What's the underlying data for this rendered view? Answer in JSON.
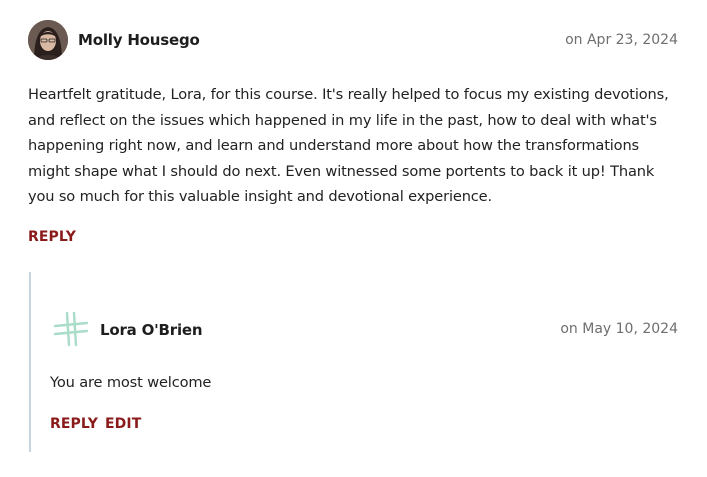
{
  "comment": {
    "author": "Molly Housego",
    "date": "on Apr 23, 2024",
    "lines": [
      "Heartfelt gratitude, Lora, for this course. It's really helped to focus my existing devotions,",
      "and reflect on the issues which happened in my life in the past, how to deal with what's",
      "happening right now, and learn and understand more about how the transformations",
      "might shape what I should do next. Even witnessed some portents to back it up! Thank",
      "you so much for this valuable insight and devotional experience."
    ],
    "reply_label": "REPLY"
  },
  "reply": {
    "author": "Lora O'Brien",
    "date": "on May 10, 2024",
    "text": "You are most welcome",
    "reply_label": "REPLY",
    "edit_label": "EDIT"
  },
  "colors": {
    "link": "#8b1a1a",
    "thread_line": "#c5d4e0",
    "logo": "#a9dcc9"
  },
  "icons": {
    "author_avatar": "avatar-photo",
    "reply_avatar": "cross-logo-icon"
  }
}
